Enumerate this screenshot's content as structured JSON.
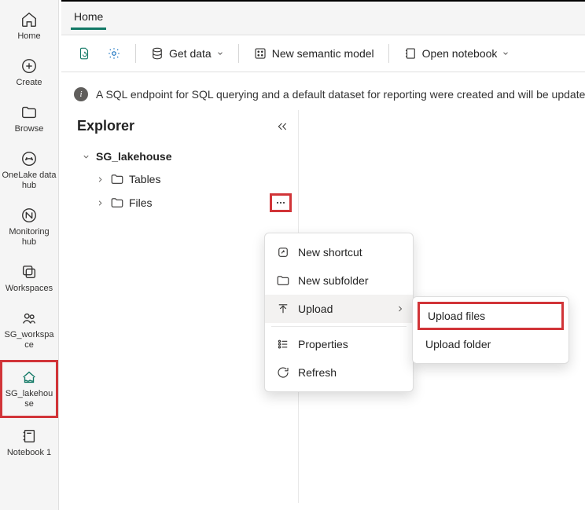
{
  "rail": {
    "home": "Home",
    "create": "Create",
    "browse": "Browse",
    "onelake": "OneLake data hub",
    "monitoring": "Monitoring hub",
    "workspaces": "Workspaces",
    "sg_workspace": "SG_workspa ce",
    "sg_lakehouse": "SG_lakehou se",
    "notebook1": "Notebook 1"
  },
  "tabs": {
    "home": "Home"
  },
  "toolbar": {
    "get_data": "Get data",
    "new_model": "New semantic model",
    "open_notebook": "Open notebook"
  },
  "info": {
    "text": "A SQL endpoint for SQL querying and a default dataset for reporting were created and will be updated wi"
  },
  "explorer": {
    "title": "Explorer",
    "root": "SG_lakehouse",
    "tables": "Tables",
    "files": "Files"
  },
  "context_menu": {
    "new_shortcut": "New shortcut",
    "new_subfolder": "New subfolder",
    "upload": "Upload",
    "properties": "Properties",
    "refresh": "Refresh"
  },
  "submenu": {
    "upload_files": "Upload files",
    "upload_folder": "Upload folder"
  }
}
